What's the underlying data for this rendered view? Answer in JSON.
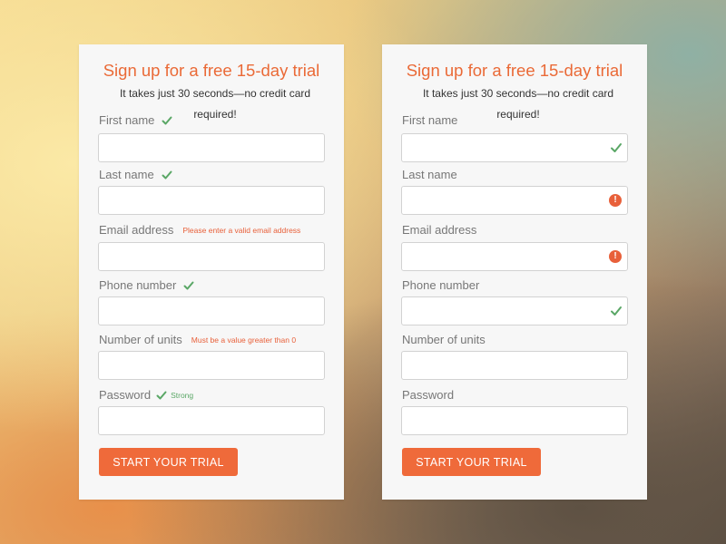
{
  "colors": {
    "accent": "#ea6a37",
    "button": "#ef6a3a",
    "success": "#5aa766",
    "error": "#e8603a"
  },
  "left_form": {
    "title": "Sign up for a free 15-day trial",
    "subtitle": "It takes just 30 seconds—no credit card required!",
    "first_name": {
      "label": "First name",
      "value": "",
      "status": "valid"
    },
    "last_name": {
      "label": "Last name",
      "value": "",
      "status": "valid"
    },
    "email": {
      "label": "Email address",
      "value": "",
      "status": "error",
      "message": "Please enter a valid email address"
    },
    "phone": {
      "label": "Phone number",
      "value": "",
      "status": "valid"
    },
    "units": {
      "label": "Number of units",
      "value": "",
      "status": "error",
      "message": "Must be a value greater than 0"
    },
    "password": {
      "label": "Password",
      "value": "",
      "status": "valid",
      "message": "Strong"
    },
    "submit_label": "START YOUR TRIAL"
  },
  "right_form": {
    "title": "Sign up for a free 15-day trial",
    "subtitle": "It takes just 30 seconds—no credit card required!",
    "first_name": {
      "label": "First name",
      "value": "",
      "status": "valid",
      "icon": "check-icon"
    },
    "last_name": {
      "label": "Last name",
      "value": "",
      "status": "error",
      "icon": "error-icon"
    },
    "email": {
      "label": "Email address",
      "value": "",
      "status": "error",
      "icon": "error-icon"
    },
    "phone": {
      "label": "Phone number",
      "value": "",
      "status": "valid",
      "icon": "check-icon"
    },
    "units": {
      "label": "Number of units",
      "value": ""
    },
    "password": {
      "label": "Password",
      "value": ""
    },
    "submit_label": "START YOUR TRIAL"
  }
}
